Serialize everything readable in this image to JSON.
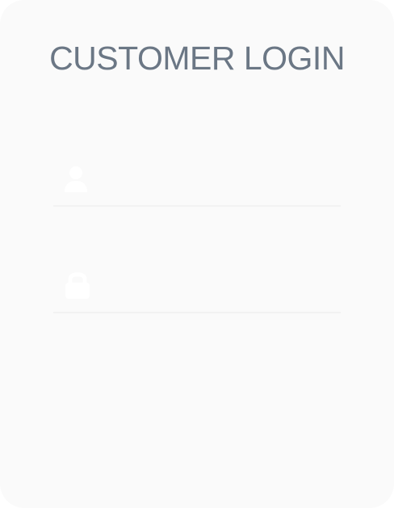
{
  "login": {
    "title": "CUSTOMER LOGIN",
    "username": {
      "icon": "user-icon",
      "value": "",
      "placeholder": ""
    },
    "password": {
      "icon": "lock-icon",
      "value": "",
      "placeholder": ""
    }
  },
  "colors": {
    "title": "#6b7785",
    "card": "#fafafa",
    "icon": "#ffffff"
  }
}
